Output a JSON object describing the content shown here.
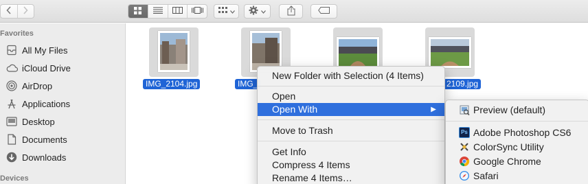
{
  "toolbar": {
    "back_icon": "chevron-left-icon",
    "forward_icon": "chevron-right-icon",
    "views": [
      "icon-view",
      "list-view",
      "column-view",
      "cover-flow-view"
    ],
    "arrange_icon": "grid-arrange-icon",
    "action_icon": "gear-icon",
    "share_icon": "share-icon",
    "tag_icon": "tag-icon"
  },
  "sidebar": {
    "favorites_header": "Favorites",
    "items": [
      {
        "label": "All My Files",
        "icon": "all-files-icon"
      },
      {
        "label": "iCloud Drive",
        "icon": "cloud-icon"
      },
      {
        "label": "AirDrop",
        "icon": "airdrop-icon"
      },
      {
        "label": "Applications",
        "icon": "applications-icon"
      },
      {
        "label": "Desktop",
        "icon": "desktop-icon"
      },
      {
        "label": "Documents",
        "icon": "documents-icon"
      },
      {
        "label": "Downloads",
        "icon": "downloads-icon"
      }
    ],
    "devices_header": "Devices"
  },
  "files": [
    {
      "name": "IMG_2104.jpg"
    },
    {
      "name": "IMG_"
    },
    {
      "name": ""
    },
    {
      "name": "2109.jpg"
    }
  ],
  "context_menu": {
    "items": [
      {
        "label": "New Folder with Selection (4 Items)"
      },
      {
        "label": "Open"
      },
      {
        "label": "Open With"
      },
      {
        "label": "Move to Trash"
      },
      {
        "label": "Get Info"
      },
      {
        "label": "Compress 4 Items"
      },
      {
        "label": "Rename 4 Items…"
      }
    ],
    "submenu_arrow": "▶"
  },
  "open_with_submenu": {
    "items": [
      {
        "label": "Preview (default)",
        "icon": "preview-app-icon"
      },
      {
        "label": "Adobe Photoshop CS6",
        "icon": "photoshop-app-icon",
        "icon_text": "Ps"
      },
      {
        "label": "ColorSync Utility",
        "icon": "colorsync-app-icon"
      },
      {
        "label": "Google Chrome",
        "icon": "chrome-app-icon"
      },
      {
        "label": "Safari",
        "icon": "safari-app-icon"
      }
    ]
  },
  "colors": {
    "selection": "#1f64d6",
    "menu_highlight": "#2f6fdd"
  }
}
